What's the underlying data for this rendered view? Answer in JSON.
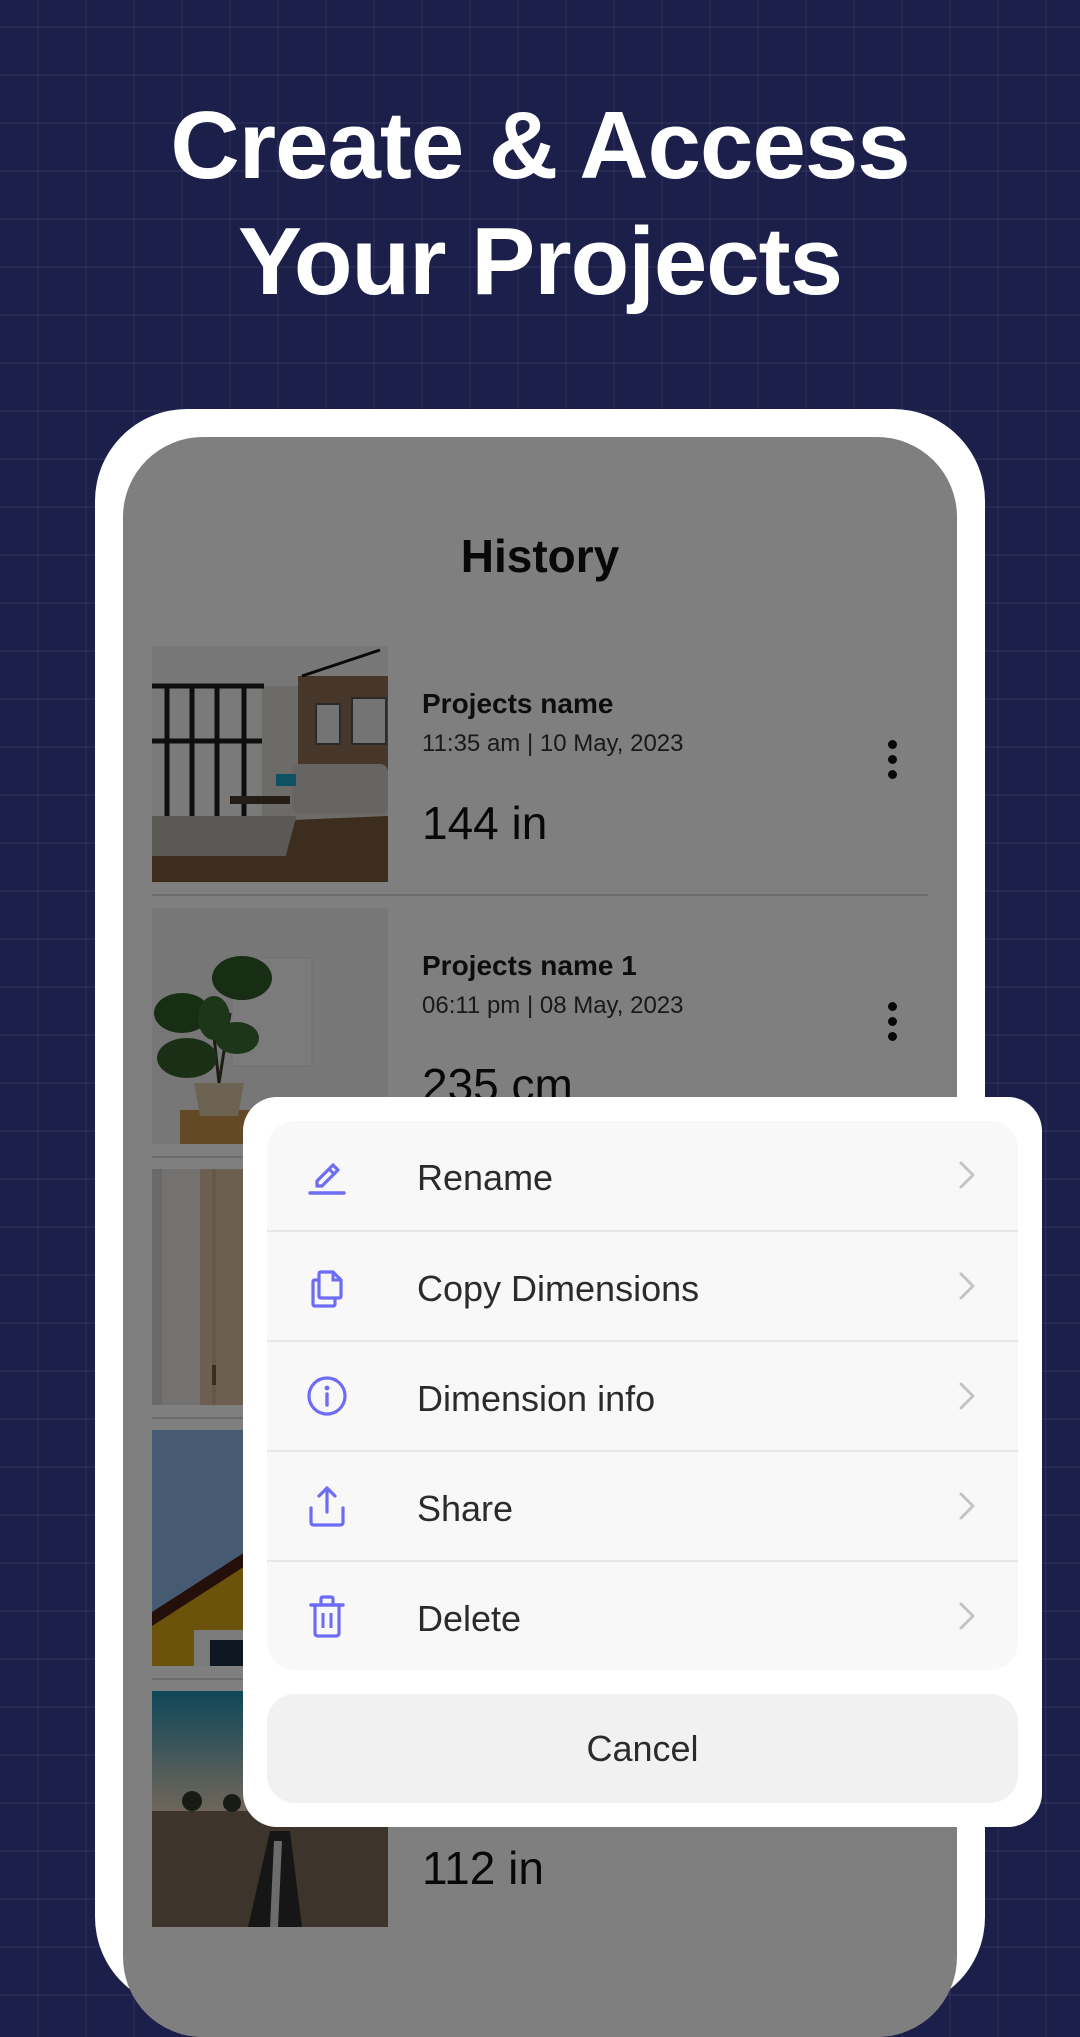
{
  "headline": {
    "line1": "Create & Access",
    "line2": "Your Projects"
  },
  "screen": {
    "title": "History",
    "items": [
      {
        "name": "Projects name",
        "date": "11:35 am | 10 May, 2023",
        "value": "144 in",
        "thumbnail": "living-room-photo"
      },
      {
        "name": "Projects name 1",
        "date": "06:11 pm | 08 May, 2023",
        "value": "235 cm",
        "thumbnail": "plant-photo"
      },
      {
        "name": "",
        "date": "",
        "value": "",
        "thumbnail": "door-photo"
      },
      {
        "name": "",
        "date": "",
        "value": "",
        "thumbnail": "house-roof-photo"
      },
      {
        "name": "",
        "date": "",
        "value": "112 in",
        "thumbnail": "trench-photo"
      }
    ]
  },
  "action_sheet": {
    "items": [
      {
        "label": "Rename",
        "icon": "pencil-icon"
      },
      {
        "label": "Copy Dimensions",
        "icon": "copy-icon"
      },
      {
        "label": "Dimension info",
        "icon": "info-icon"
      },
      {
        "label": "Share",
        "icon": "share-icon"
      },
      {
        "label": "Delete",
        "icon": "trash-icon"
      }
    ],
    "cancel_label": "Cancel"
  },
  "colors": {
    "background": "#1b1f4a",
    "accent_icon": "#6c6cf5",
    "chevron": "#c4c4c4",
    "overlay": "rgba(0,0,0,0.5)"
  }
}
